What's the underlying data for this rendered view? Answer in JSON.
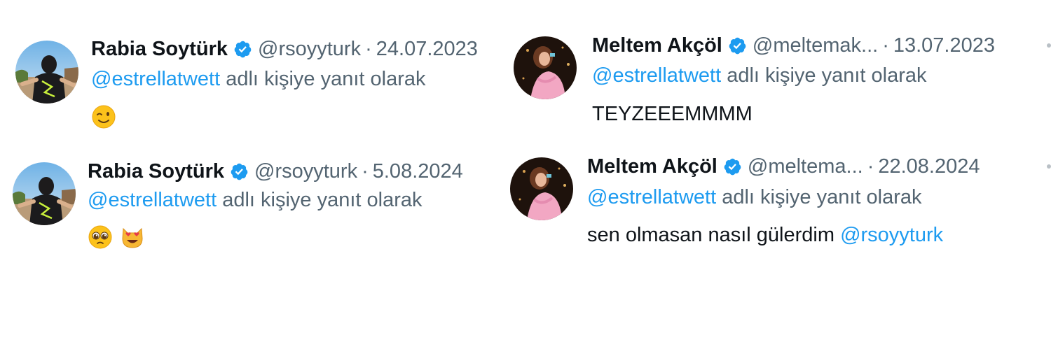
{
  "colors": {
    "mention": "#1d9bf0",
    "muted": "#536471",
    "text": "#0f1419",
    "verified": "#1d9bf0"
  },
  "tweets": [
    {
      "name": "Rabia Soytürk",
      "handle": "@rsoyyturk",
      "separator": "·",
      "date": "24.07.2023",
      "reply_mention": "@estrellatwett",
      "reply_suffix": " adlı kişiye yanıt olarak",
      "body_text": "",
      "emojis": [
        "winking-face-emoji"
      ]
    },
    {
      "name": "Meltem Akçöl",
      "handle": "@meltemak...",
      "separator": "·",
      "date": "13.07.2023",
      "reply_mention": "@estrellatwett",
      "reply_suffix": " adlı kişiye yanıt olarak",
      "body_text": "TEYZEEEMMMM",
      "emojis": []
    },
    {
      "name": "Rabia Soytürk",
      "handle": "@rsoyyturk",
      "separator": "·",
      "date": "5.08.2024",
      "reply_mention": "@estrellatwett",
      "reply_suffix": " adlı kişiye yanıt olarak",
      "body_text": "",
      "emojis": [
        "pleading-face-emoji",
        "heart-eyes-cat-emoji"
      ]
    },
    {
      "name": "Meltem Akçöl",
      "handle": "@meltema...",
      "separator": "·",
      "date": "22.08.2024",
      "reply_mention": "@estrellatwett",
      "reply_suffix": " adlı kişiye yanıt olarak",
      "body_text": "sen olmasan nasıl gülerdim ",
      "body_mention": "@rsoyyturk",
      "emojis": []
    }
  ]
}
